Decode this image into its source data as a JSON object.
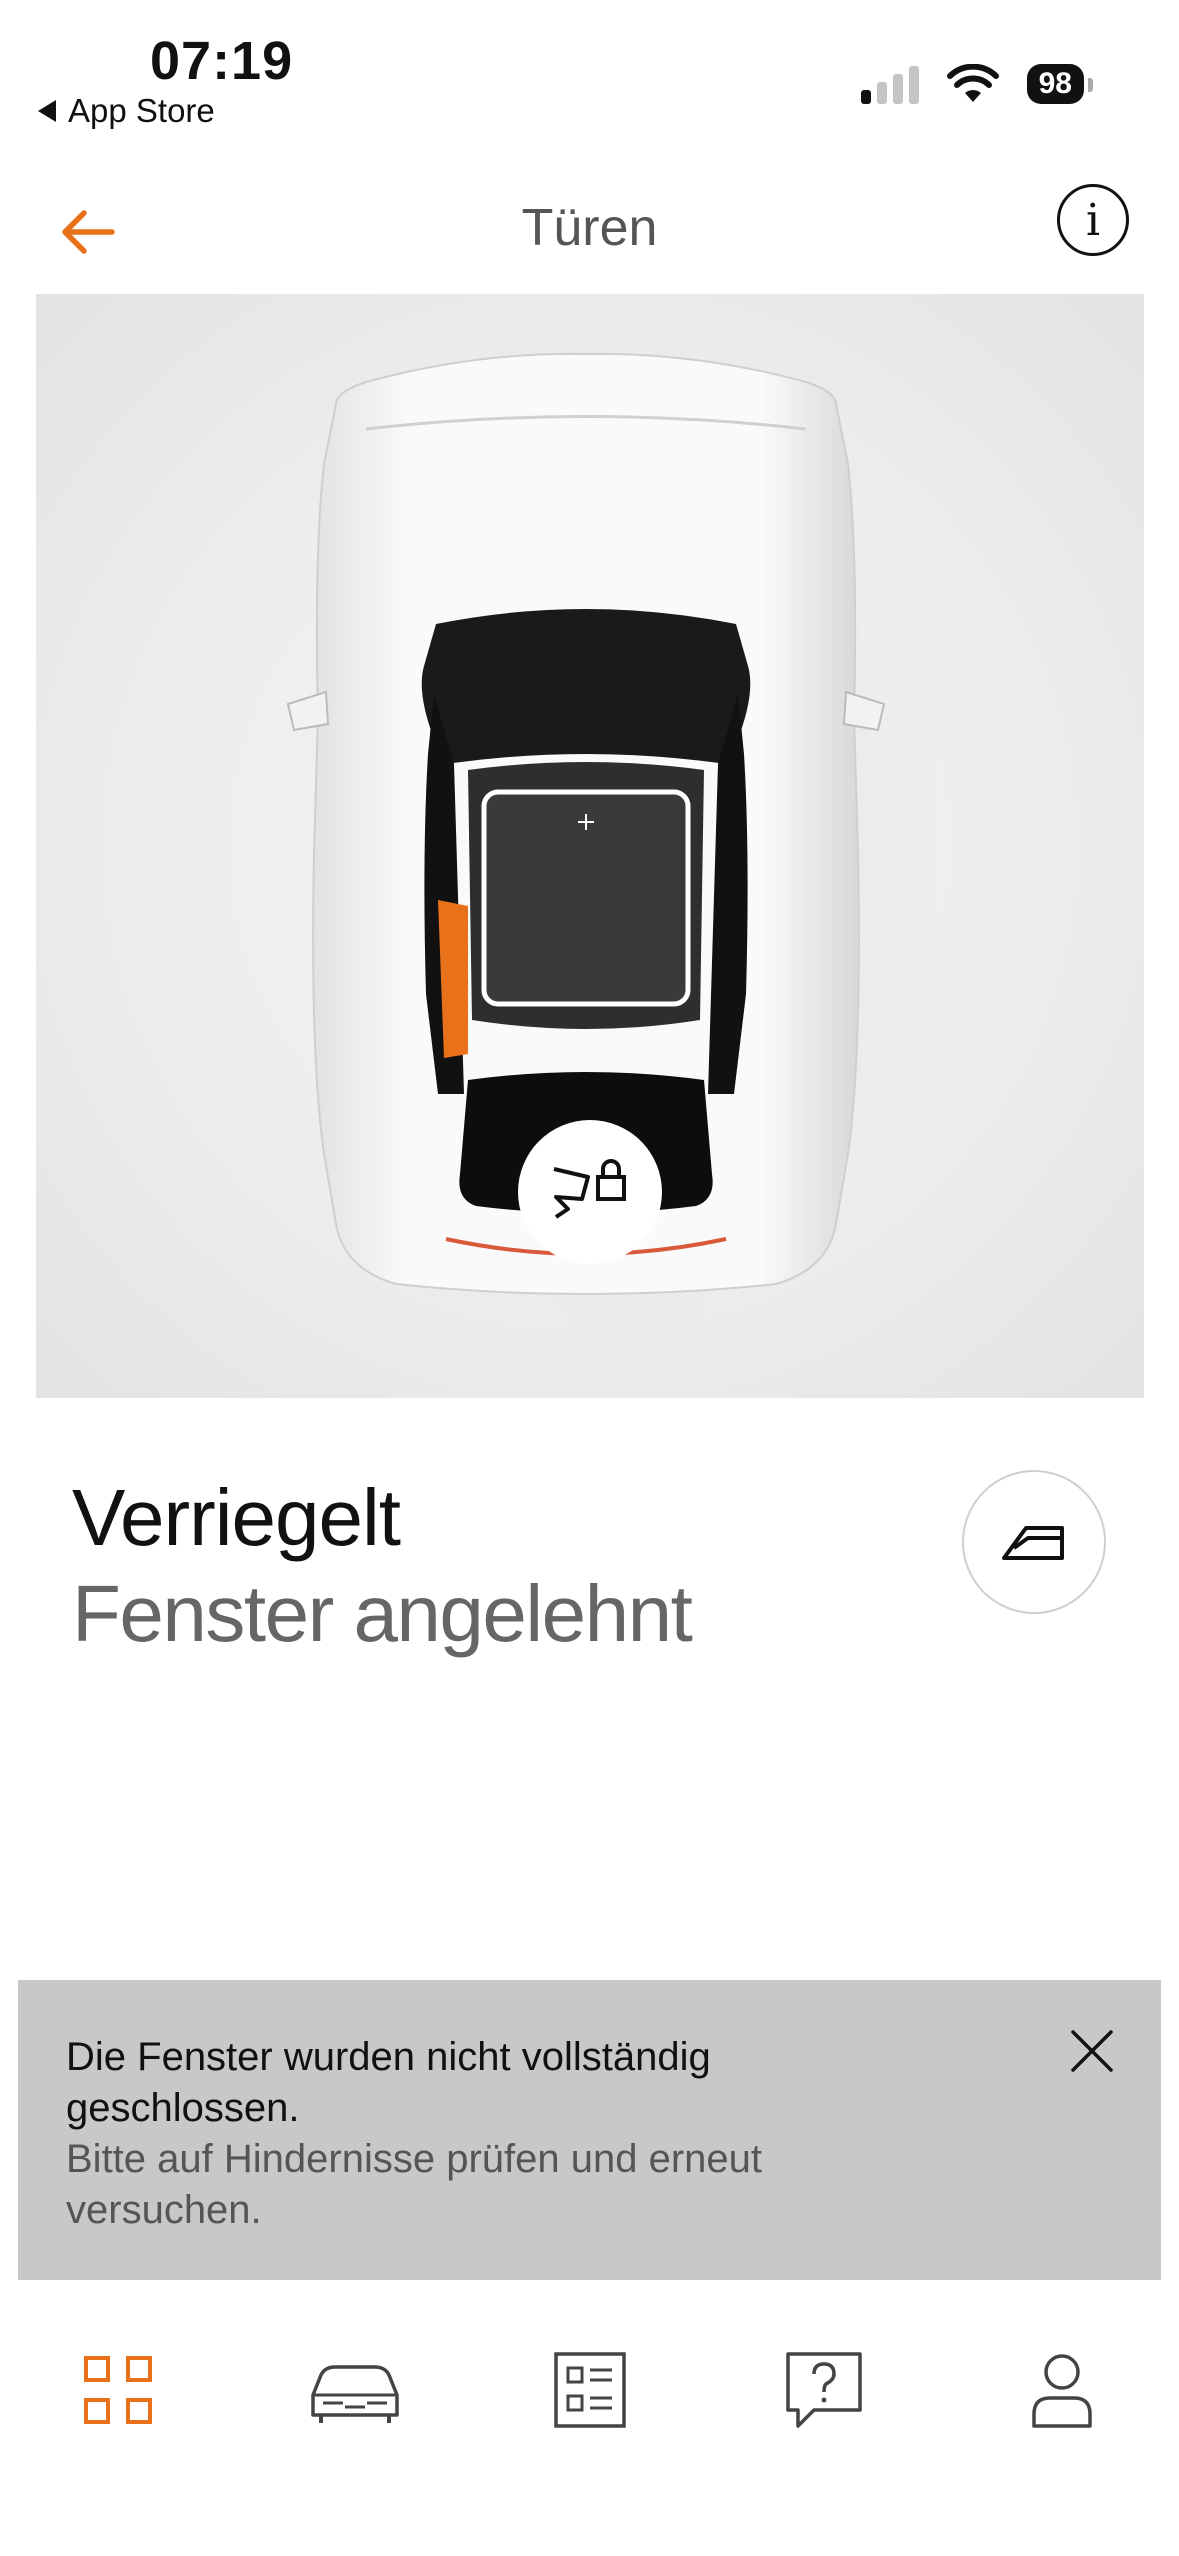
{
  "status_bar": {
    "time": "07:19",
    "back_app": "App Store",
    "battery": "98"
  },
  "header": {
    "title": "Türen",
    "info_glyph": "i",
    "back_icon": "arrow-left-icon",
    "accent_color": "#e8711a"
  },
  "car": {
    "highlight_color": "#e8711a",
    "lock_icon": "car-door-lock-icon"
  },
  "vehicle_status": {
    "lock_state": "Verriegelt",
    "window_state": "Fenster angelehnt",
    "window_icon": "car-window-icon"
  },
  "banner": {
    "title": "Die Fenster wurden nicht vollständig geschlossen.",
    "body": "Bitte auf Hindernisse prüfen und erneut versuchen.",
    "close_icon": "close-icon"
  },
  "tabbar": {
    "tabs": [
      {
        "icon": "grid-icon",
        "active": true
      },
      {
        "icon": "car-icon",
        "active": false
      },
      {
        "icon": "list-icon",
        "active": false
      },
      {
        "icon": "help-icon",
        "active": false
      },
      {
        "icon": "profile-icon",
        "active": false
      }
    ]
  }
}
